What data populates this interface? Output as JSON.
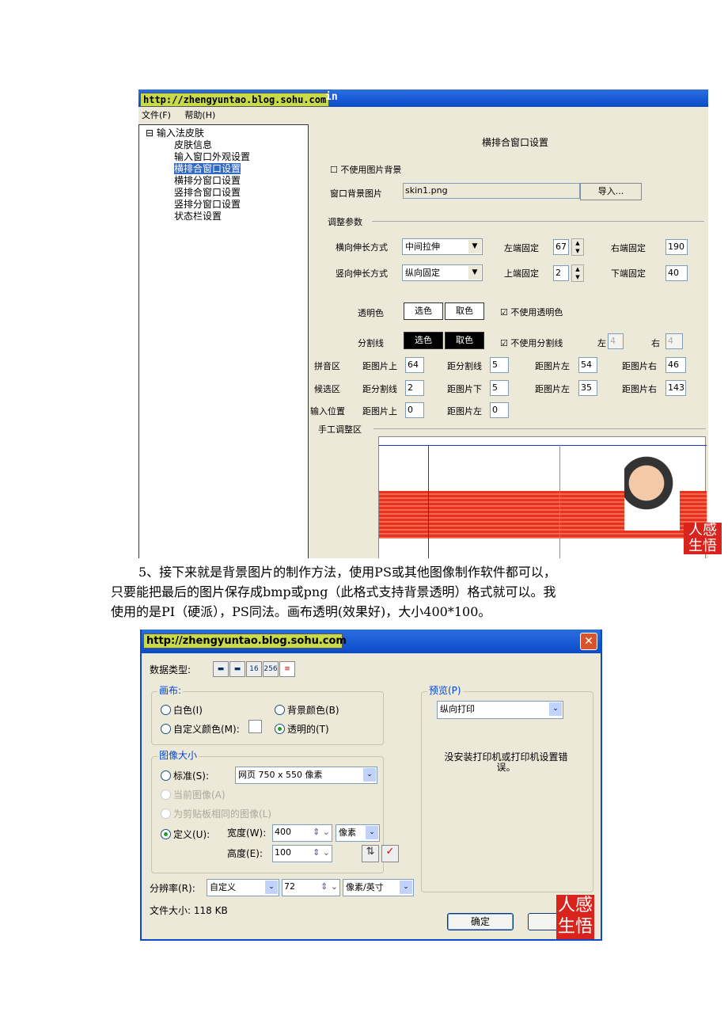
{
  "shot1": {
    "title_url": "http://zhengyuntao.blog.sohu.com",
    "title_suffix": "in",
    "menu": [
      "文件(F)",
      "帮助(H)"
    ],
    "tree": {
      "root": "输入法皮肤",
      "items": [
        "皮肤信息",
        "输入窗口外观设置",
        "横排合窗口设置",
        "横排分窗口设置",
        "竖排合窗口设置",
        "竖排分窗口设置",
        "状态栏设置"
      ],
      "selected": "横排合窗口设置"
    },
    "panel_title": "横排合窗口设置",
    "no_bg_checkbox": "不使用图片背景",
    "bg_label": "窗口背景图片",
    "bg_value": "skin1.png",
    "import_button": "导入...",
    "adjust_group": "调整参数",
    "h_stretch_label": "横向伸长方式",
    "h_stretch_value": "中间拉伸",
    "v_stretch_label": "竖向伸长方式",
    "v_stretch_value": "纵向固定",
    "left_fixed_label": "左端固定",
    "left_fixed": "67",
    "right_fixed_label": "右端固定",
    "right_fixed": "190",
    "top_fixed_label": "上端固定",
    "top_fixed": "2",
    "bottom_fixed_label": "下端固定",
    "bottom_fixed": "40",
    "transparent_label": "透明色",
    "pick": "选色",
    "take": "取色",
    "no_transparent": "不使用透明色",
    "divider_label": "分割线",
    "no_divider": "不使用分割线",
    "left": "左",
    "right": "右",
    "divider_left": "4",
    "divider_right": "4",
    "pinyin_label": "拼音区",
    "cand_label": "候选区",
    "input_pos_label": "输入位置",
    "dist_top": "距图片上",
    "dist_div": "距分割线",
    "dist_left": "距图片左",
    "dist_right": "距图片右",
    "dist_bottom": "距图片下",
    "pinyin": [
      "64",
      "5",
      "54",
      "46"
    ],
    "cand": [
      "2",
      "5",
      "35",
      "143"
    ],
    "input_pos": [
      "0",
      "0"
    ],
    "manual_group": "手工调整区"
  },
  "paragraph": [
    "5、接下来就是背景图片的制作方法，使用PS或其他图像制作软件都可以，",
    "只要能把最后的图片保存成bmp或png（此格式支持背景透明）格式就可以。我",
    "使用的是PI（硬派），PS同法。画布透明(效果好)，大小400*100。"
  ],
  "shot2": {
    "title_url": "http://zhengyuntao.blog.sohu.com",
    "data_type_label": "数据类型:",
    "data_type_buttons": [
      "16",
      "256"
    ],
    "canvas_group": "画布:",
    "white": "白色(I)",
    "bg_color": "背景颜色(B)",
    "custom_color": "自定义颜色(M):",
    "transparent": "透明的(T)",
    "size_group": "图像大小",
    "standard": "标准(S):",
    "standard_value": "网页 750 x 550 像素",
    "current": "当前图像(A)",
    "clipboard": "为剪贴板相同的图像(L)",
    "custom": "定义(U):",
    "width_label": "宽度(W):",
    "width": "400",
    "unit": "像素",
    "height_label": "高度(E):",
    "height": "100",
    "resolution_label": "分辨率(R):",
    "resolution_preset": "自定义",
    "resolution": "72",
    "resolution_unit": "像素/英寸",
    "file_size": "文件大小: 118 KB",
    "preview_group": "预览(P)",
    "preview_value": "纵向打印",
    "preview_msg": "没安装打印机或打印机设置错误。",
    "ok": "确定",
    "cancel": "取"
  },
  "seal_text": "人感生悟",
  "colors": {
    "titlebar": "#0a4ac8",
    "selection": "#316ac5",
    "seal": "#d8241d",
    "url_bg": "#c8d94a"
  }
}
